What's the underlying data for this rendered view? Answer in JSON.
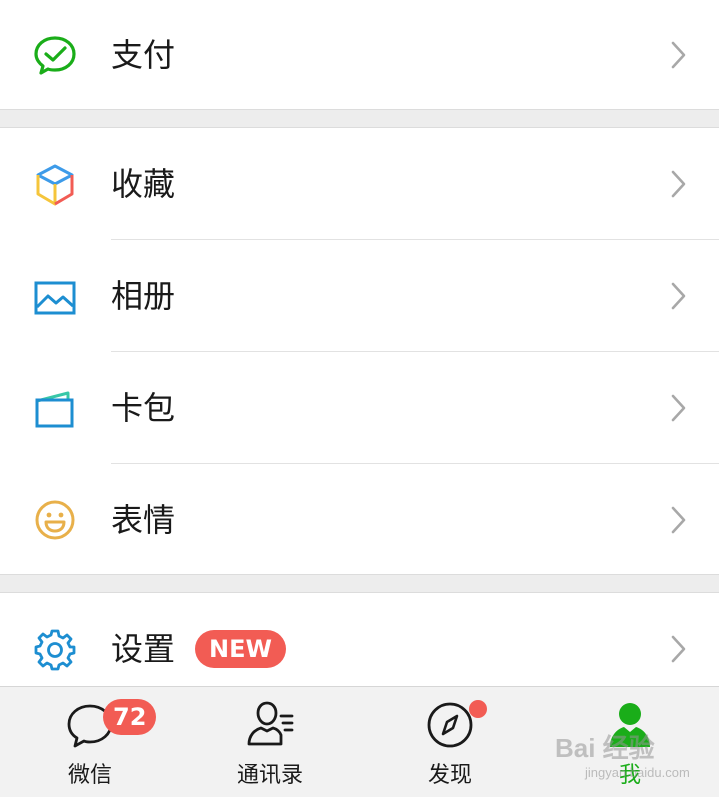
{
  "menu": {
    "pay": {
      "label": "支付",
      "icon": "wechat-pay-icon"
    },
    "favorites": {
      "label": "收藏",
      "icon": "cube-icon"
    },
    "album": {
      "label": "相册",
      "icon": "image-icon"
    },
    "cards": {
      "label": "卡包",
      "icon": "card-wallet-icon"
    },
    "stickers": {
      "label": "表情",
      "icon": "smiley-icon"
    },
    "settings": {
      "label": "设置",
      "icon": "gear-icon",
      "badge": "NEW"
    }
  },
  "tabbar": {
    "chats": {
      "label": "微信",
      "badge": "72",
      "icon": "chat-bubble-icon"
    },
    "contacts": {
      "label": "通讯录",
      "icon": "contacts-icon"
    },
    "discover": {
      "label": "发现",
      "icon": "compass-icon",
      "has_dot": true
    },
    "me": {
      "label": "我",
      "icon": "person-icon",
      "active": true
    }
  },
  "watermark": {
    "text": "Bai 经验",
    "sub": "jingyan.baidu.com"
  },
  "colors": {
    "accent_green": "#1aad19",
    "badge_red": "#f25c54",
    "background": "#ededed"
  }
}
